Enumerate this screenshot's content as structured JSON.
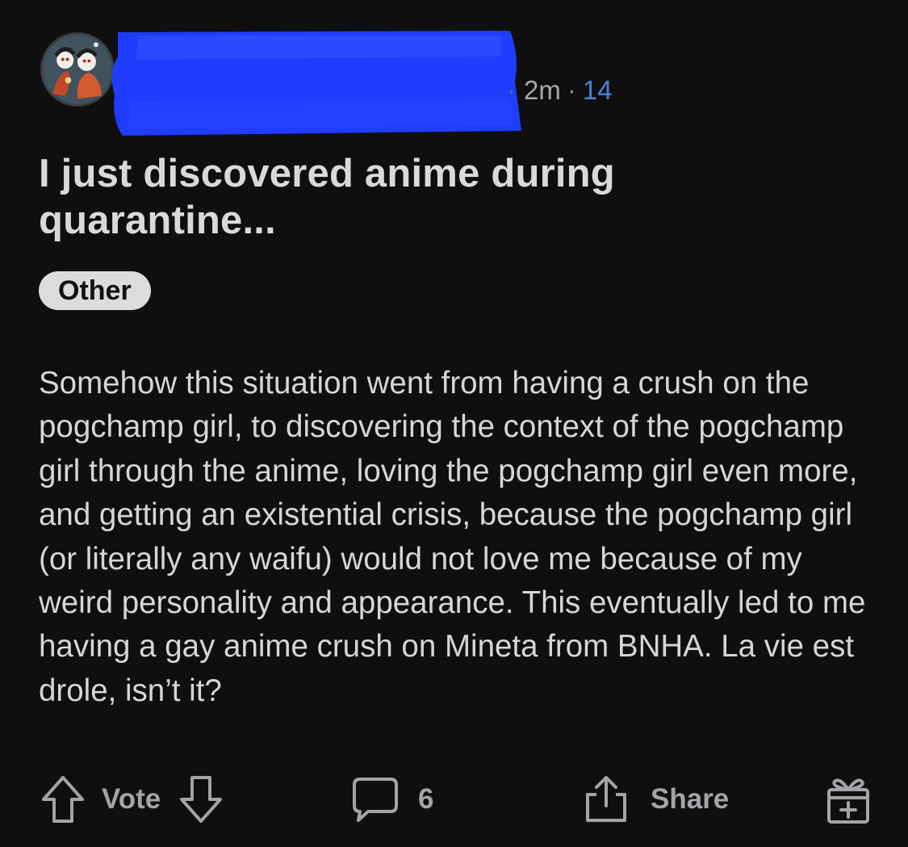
{
  "post": {
    "time": "2m",
    "score": "14",
    "title": "I just discovered anime during quarantine...",
    "flair": "Other",
    "body": "Somehow this situation went from having a crush on the pogchamp girl, to discovering the context of the pogchamp girl through the anime, loving the pogchamp girl even more, and getting an existential crisis, because the pogchamp girl (or literally any waifu) would not love me because of my weird personality and appearance. This eventually led to me having a gay anime crush on Mineta from BNHA. La vie est drole, isn’t it?"
  },
  "actions": {
    "vote_label": "Vote",
    "comment_count": "6",
    "share_label": "Share"
  },
  "icons": {
    "upvote": "arrow-up-outline-icon",
    "downvote": "arrow-down-outline-icon",
    "comment": "speech-bubble-icon",
    "share": "share-upload-icon",
    "award": "gift-award-icon"
  },
  "colors": {
    "background": "#0f0f10",
    "text": "#d7dadc",
    "meta": "#a8a8ad",
    "score": "#4a84d4",
    "flair_bg": "#dcdcde",
    "redaction": "#1f3cff"
  }
}
